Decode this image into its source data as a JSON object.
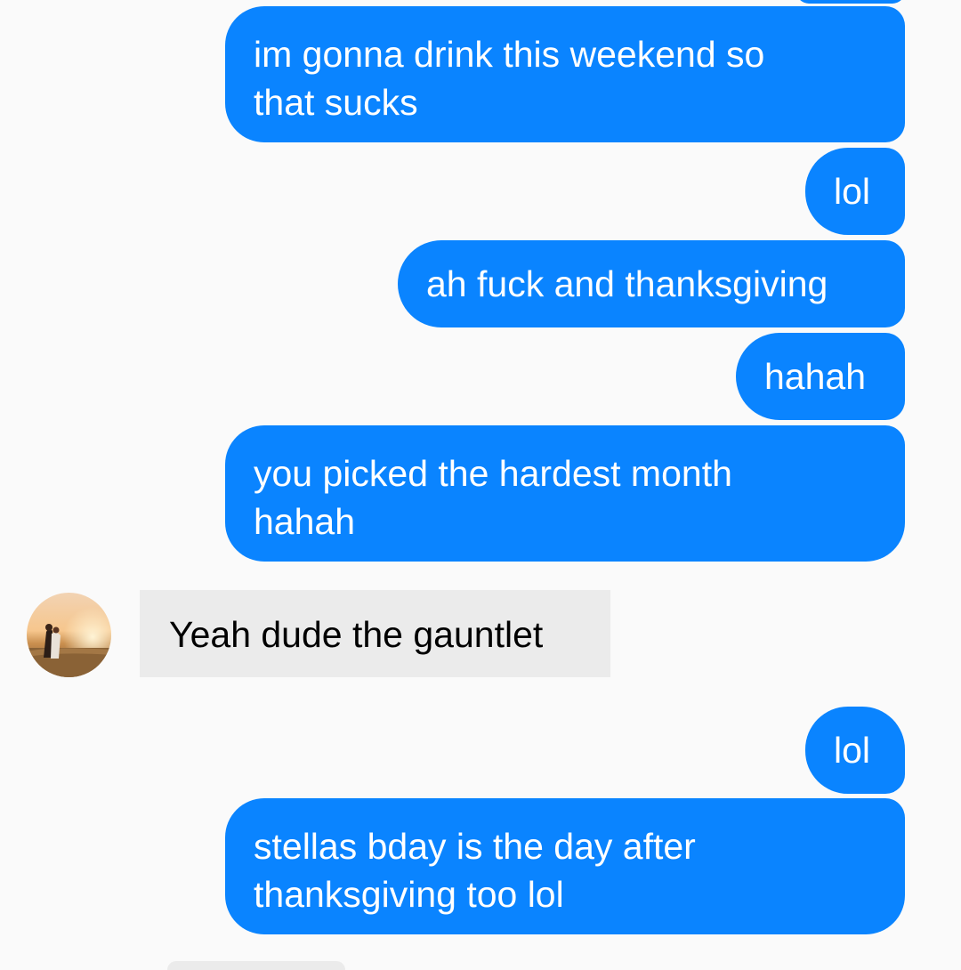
{
  "conversation": {
    "messages": [
      {
        "direction": "outgoing",
        "text": "im gonna drink this weekend so\nthat sucks"
      },
      {
        "direction": "outgoing",
        "text": "lol"
      },
      {
        "direction": "outgoing",
        "text": "ah fuck and thanksgiving"
      },
      {
        "direction": "outgoing",
        "text": "hahah"
      },
      {
        "direction": "outgoing",
        "text": "you picked the hardest month\nhahah"
      },
      {
        "direction": "incoming",
        "text": "Yeah dude the gauntlet"
      },
      {
        "direction": "outgoing",
        "text": "lol"
      },
      {
        "direction": "outgoing",
        "text": "stellas bday is the day after\nthanksgiving too lol"
      }
    ]
  },
  "colors": {
    "outgoing_bubble": "#0a84ff",
    "incoming_bubble": "#ebebeb",
    "background": "#fafafa"
  },
  "icons": {
    "contact_avatar": "contact-avatar-photo"
  }
}
